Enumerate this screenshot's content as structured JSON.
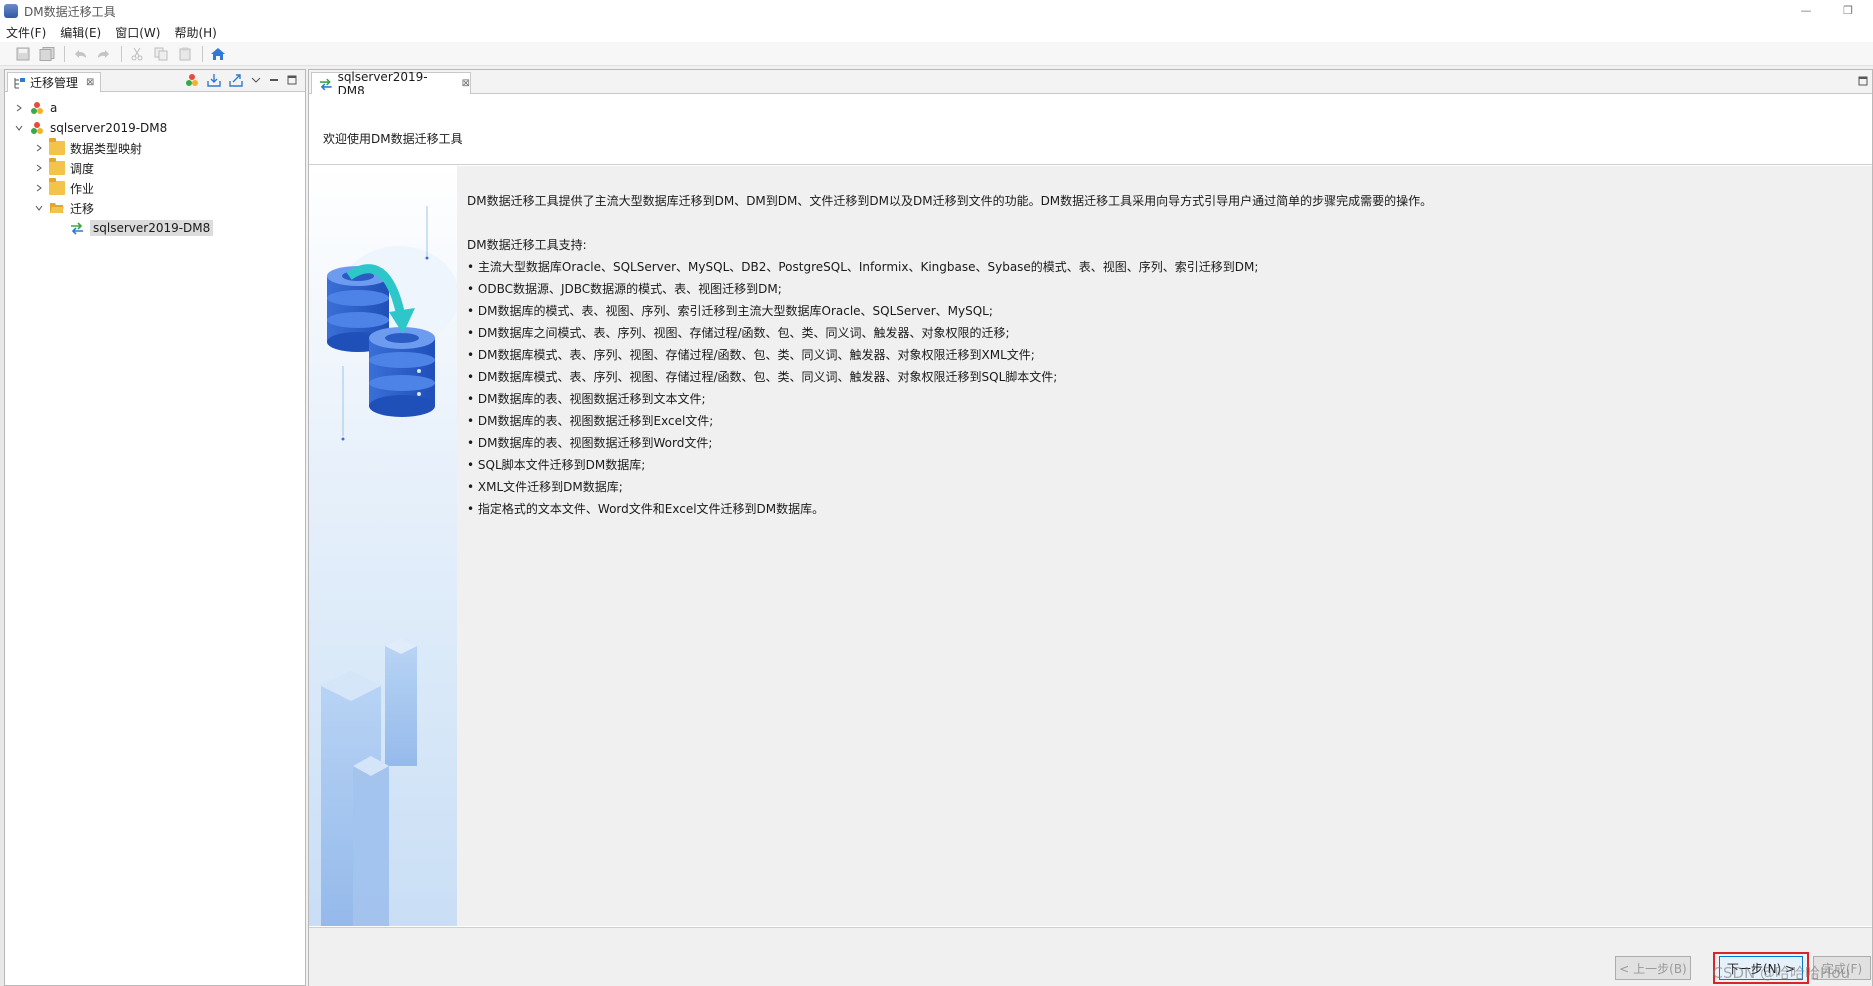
{
  "window": {
    "title": "DM数据迁移工具",
    "restore_glyph": "❐",
    "minimize_glyph": "—"
  },
  "menu": [
    {
      "label": "文件(F)"
    },
    {
      "label": "编辑(E)"
    },
    {
      "label": "窗口(W)"
    },
    {
      "label": "帮助(H)"
    }
  ],
  "toolbar": {
    "icons": [
      "save-icon",
      "save-all-icon",
      "undo-icon",
      "redo-icon",
      "cut-icon",
      "copy-icon",
      "paste-icon",
      "home-icon"
    ]
  },
  "left_panel": {
    "tab_label": "迁移管理",
    "tab_close": "⊠",
    "tree": [
      {
        "label": "a",
        "level": 0,
        "expanded": false,
        "type": "project"
      },
      {
        "label": "sqlserver2019-DM8",
        "level": 0,
        "expanded": true,
        "type": "project"
      },
      {
        "label": "数据类型映射",
        "level": 1,
        "expanded": false,
        "type": "folder"
      },
      {
        "label": "调度",
        "level": 1,
        "expanded": false,
        "type": "folder"
      },
      {
        "label": "作业",
        "level": 1,
        "expanded": false,
        "type": "folder"
      },
      {
        "label": "迁移",
        "level": 1,
        "expanded": true,
        "type": "folder-open"
      },
      {
        "label": "sqlserver2019-DM8",
        "level": 2,
        "expanded": null,
        "type": "migration",
        "selected": true
      }
    ]
  },
  "editor": {
    "tab_label": "sqlserver2019-DM8",
    "tab_close": "⊠",
    "wizard_title": "欢迎使用DM数据迁移工具",
    "intro": "DM数据迁移工具提供了主流大型数据库迁移到DM、DM到DM、文件迁移到DM以及DM迁移到文件的功能。DM数据迁移工具采用向导方式引导用户通过简单的步骤完成需要的操作。",
    "support_heading": "DM数据迁移工具支持:",
    "support_items": [
      "主流大型数据库Oracle、SQLServer、MySQL、DB2、PostgreSQL、Informix、Kingbase、Sybase的模式、表、视图、序列、索引迁移到DM;",
      "ODBC数据源、JDBC数据源的模式、表、视图迁移到DM;",
      "DM数据库的模式、表、视图、序列、索引迁移到主流大型数据库Oracle、SQLServer、MySQL;",
      "DM数据库之间模式、表、序列、视图、存储过程/函数、包、类、同义词、触发器、对象权限的迁移;",
      "DM数据库模式、表、序列、视图、存储过程/函数、包、类、同义词、触发器、对象权限迁移到XML文件;",
      "DM数据库模式、表、序列、视图、存储过程/函数、包、类、同义词、触发器、对象权限迁移到SQL脚本文件;",
      "DM数据库的表、视图数据迁移到文本文件;",
      "DM数据库的表、视图数据迁移到Excel文件;",
      "DM数据库的表、视图数据迁移到Word文件;",
      "SQL脚本文件迁移到DM数据库;",
      "XML文件迁移到DM数据库;",
      "指定格式的文本文件、Word文件和Excel文件迁移到DM数据库。"
    ]
  },
  "footer": {
    "back_label": "< 上一步(B)",
    "next_label": "下一步(N) >",
    "finish_label": "完成(F)",
    "watermark": "CSDN @哈哈哈Hou"
  }
}
